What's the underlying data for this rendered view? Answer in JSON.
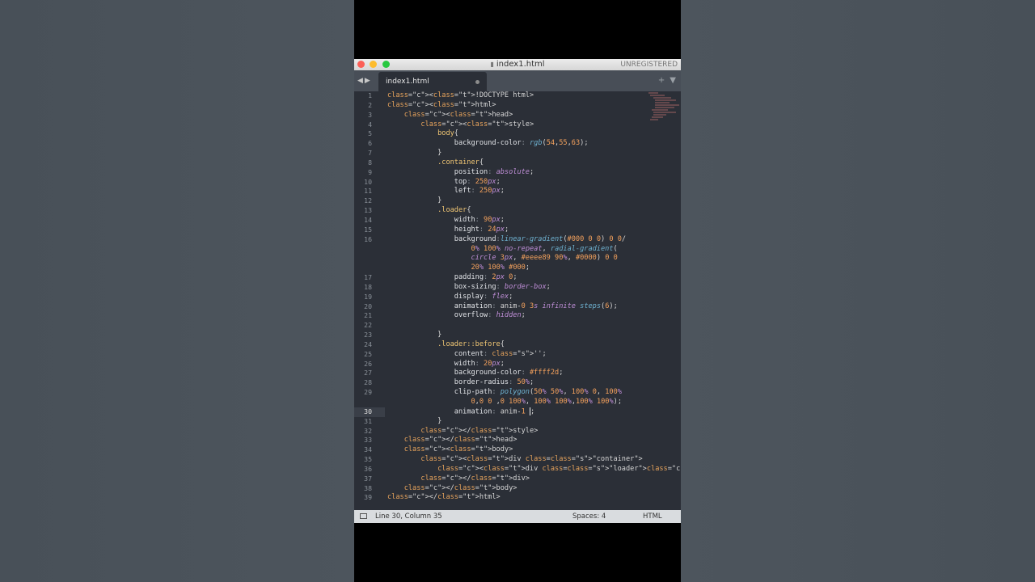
{
  "window": {
    "filename": "index1.html",
    "registration": "UNREGISTERED"
  },
  "tabs": [
    {
      "label": "index1.html",
      "modified": true
    }
  ],
  "status": {
    "position": "Line 30, Column 35",
    "spaces": "Spaces: 4",
    "syntax": "HTML"
  },
  "gutter": [
    "1",
    "2",
    "3",
    "4",
    "5",
    "6",
    "7",
    "8",
    "9",
    "10",
    "11",
    "12",
    "13",
    "14",
    "15",
    "16",
    "",
    "",
    "",
    "17",
    "18",
    "19",
    "20",
    "21",
    "22",
    "23",
    "24",
    "25",
    "26",
    "27",
    "28",
    "29",
    "",
    "30",
    "31",
    "32",
    "33",
    "34",
    "35",
    "36",
    "37",
    "38",
    "39"
  ],
  "active_line_number": "30",
  "code_lines": [
    "<!DOCTYPE html>",
    "<html>",
    "    <head>",
    "        <style>",
    "            body{",
    "                background-color: rgb(54,55,63);",
    "            }",
    "            .container{",
    "                position: absolute;",
    "                top: 250px;",
    "                left: 250px;",
    "            }",
    "            .loader{",
    "                width: 90px;",
    "                height: 24px;",
    "                background:linear-gradient(#000 0 0) 0 0/",
    "                    0% 100% no-repeat, radial-gradient(",
    "                    circle 3px, #eeee89 90%, #0000) 0 0",
    "                    20% 100% #000;",
    "                padding: 2px 0;",
    "                box-sizing: border-box;",
    "                display: flex;",
    "                animation: anim-0 3s infinite steps(6);",
    "                overflow: hidden;",
    "",
    "            }",
    "            .loader::before{",
    "                content: '';",
    "                width: 20px;",
    "                background-color: #ffff2d;",
    "                border-radius: 50%;",
    "                clip-path: polygon(50% 50%, 100% 0, 100%",
    "                    0,0 0 ,0 100%, 100% 100%,100% 100%);",
    "                animation: anim-1 ;",
    "            }",
    "        </style>",
    "    </head>",
    "    <body>",
    "        <div class=\"container\">",
    "            <div class=\"loader\"></div>",
    "        </div>",
    "    </body>",
    "</html>"
  ],
  "icons": {
    "close": "red-dot",
    "minimize": "yellow-dot",
    "zoom": "green-dot",
    "file": "file-icon",
    "nav": "arrows-icon",
    "new_tab": "plus-icon",
    "tab_menu": "chevron-down-icon",
    "panel_toggle": "panel-icon"
  },
  "colors": {
    "editor_bg": "#2b2f37",
    "tab_bar_bg": "#484e57",
    "status_bg": "#d9dcdf"
  }
}
